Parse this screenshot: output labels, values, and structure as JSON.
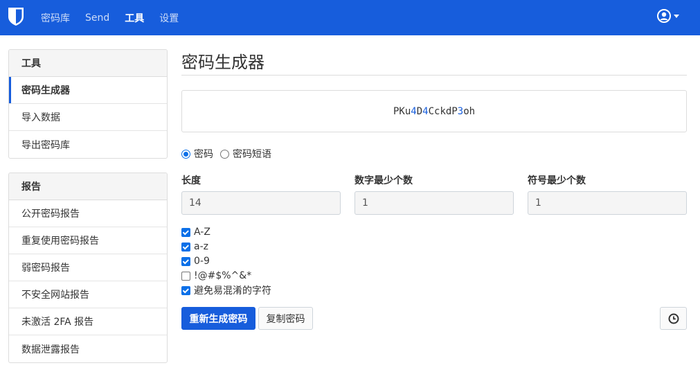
{
  "navbar": {
    "items": [
      {
        "label": "密码库",
        "active": false
      },
      {
        "label": "Send",
        "active": false
      },
      {
        "label": "工具",
        "active": true
      },
      {
        "label": "设置",
        "active": false
      }
    ]
  },
  "tools_card": {
    "header": "工具",
    "items": [
      "密码生成器",
      "导入数据",
      "导出密码库"
    ]
  },
  "reports_card": {
    "header": "报告",
    "items": [
      "公开密码报告",
      "重复使用密码报告",
      "弱密码报告",
      "不安全网站报告",
      "未激活 2FA 报告",
      "数据泄露报告"
    ]
  },
  "main": {
    "title": "密码生成器",
    "generated_password": "PKu4D4CckdP3oh",
    "type_options": [
      {
        "label": "密码",
        "checked": true
      },
      {
        "label": "密码短语",
        "checked": false
      }
    ],
    "fields": [
      {
        "label": "长度",
        "value": "14"
      },
      {
        "label": "数字最少个数",
        "value": "1"
      },
      {
        "label": "符号最少个数",
        "value": "1"
      }
    ],
    "checkboxes": [
      {
        "label": "A-Z",
        "checked": true
      },
      {
        "label": "a-z",
        "checked": true
      },
      {
        "label": "0-9",
        "checked": true
      },
      {
        "label": "!@#$%^&*",
        "checked": false
      },
      {
        "label": "避免易混淆的字符",
        "checked": true
      }
    ],
    "regenerate_label": "重新生成密码",
    "copy_label": "复制密码"
  },
  "colors": {
    "brand": "#175ddc",
    "digit": "#175ddc"
  }
}
